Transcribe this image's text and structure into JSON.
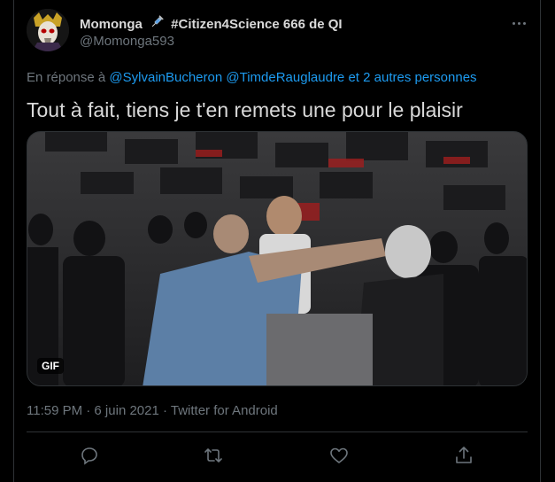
{
  "tweet": {
    "display_name": "Momonga",
    "name_suffix": "#Citizen4Science 666 de QI",
    "handle": "@Momonga593",
    "reply_prefix": "En réponse à",
    "reply_users": [
      "@SylvainBucheron",
      "@TimdeRauglaudre"
    ],
    "reply_others": "et 2 autres personnes",
    "text": "Tout à fait, tiens je t'en remets une pour le plaisir",
    "media_badge": "GIF",
    "timestamp": "11:59 PM · 6 juin 2021 · Twitter for Android"
  },
  "icons": {
    "name_emoji": "syringe-icon",
    "more": "more-icon",
    "reply": "reply-icon",
    "retweet": "retweet-icon",
    "like": "like-icon",
    "share": "share-icon"
  },
  "colors": {
    "background": "#000000",
    "text": "#d9d9d9",
    "secondary": "#6e767d",
    "link": "#1d9bf0",
    "border": "#2f3336"
  }
}
